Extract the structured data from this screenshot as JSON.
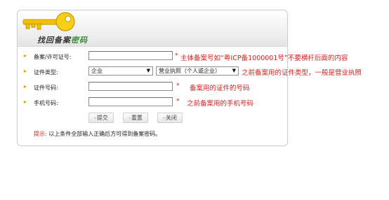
{
  "panel": {
    "title_part1": "找回备案",
    "title_part2": "密码"
  },
  "form": {
    "record_label": "备案/许可证号:",
    "record_value": "",
    "record_note": "主体备案号如“粤ICP备1000001号”不要横杆后面的内容",
    "cert_type_label": "证件类型:",
    "cert_category_selected": "企业",
    "cert_type_selected": "营业执照（个人或企业）",
    "cert_type_note": "之前备案用的证件类型，一般是营业执照",
    "cert_number_label": "证件号码:",
    "cert_number_value": "",
    "cert_number_note": "备案用的证件的号码",
    "phone_label": "手机号码:",
    "phone_value": "",
    "phone_note": "之前备案用的手机号码",
    "required_mark": "*"
  },
  "buttons": {
    "submit": "提交",
    "reset": "重置",
    "close": "关闭"
  },
  "tip": {
    "label": "提示:",
    "text": "以上条件全部输入正确后方可得到备案密码。"
  },
  "icons": {
    "key": "key-icon",
    "bullet": "bullet-icon",
    "dropdown": "chevron-down-icon",
    "button_glyph": "arrow-right-icon"
  },
  "colors": {
    "required": "#d42020",
    "bullet": "#e8a000",
    "key": "#f2c200",
    "title_highlight": "#3a8b3a"
  }
}
